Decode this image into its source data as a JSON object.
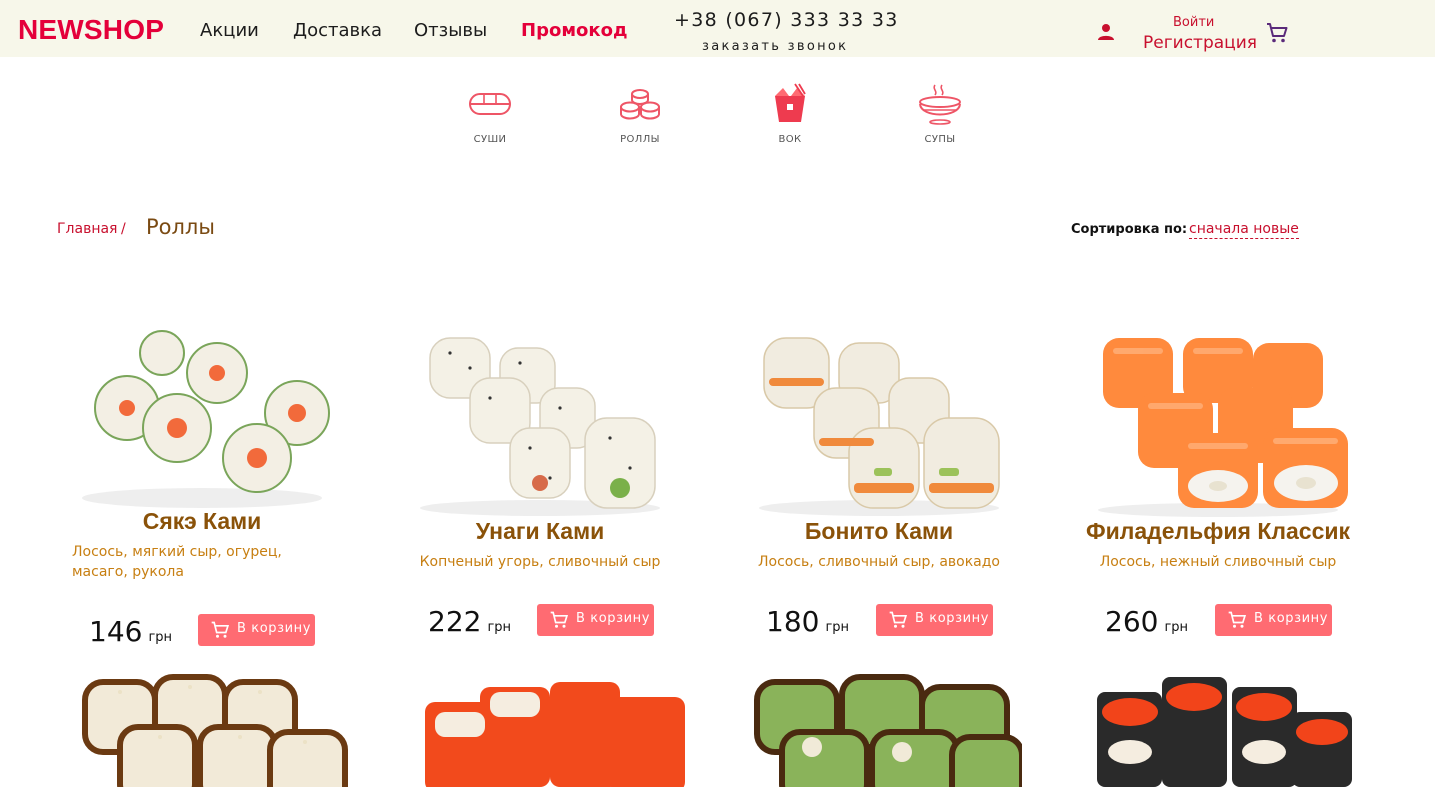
{
  "header": {
    "logo": "NEWSHOP",
    "nav": [
      {
        "label": "Акции"
      },
      {
        "label": "Доставка"
      },
      {
        "label": "Отзывы"
      },
      {
        "label": "Промокод"
      }
    ],
    "phone": "+38 (067) 333 33 33",
    "callback": "заказать звонок",
    "login": "Войти",
    "register": "Регистрация",
    "icons": [
      "user-icon",
      "cart-icon"
    ]
  },
  "categories": [
    {
      "label": "СУШИ",
      "icon": "sushi-icon"
    },
    {
      "label": "РОЛЛЫ",
      "icon": "rolls-icon"
    },
    {
      "label": "ВОК",
      "icon": "wok-icon"
    },
    {
      "label": "СУПЫ",
      "icon": "soup-icon"
    }
  ],
  "breadcrumb": {
    "home": "Главная",
    "separator": "/",
    "current": "Роллы"
  },
  "sort": {
    "label": "Сортировка по:",
    "value": "сначала новые"
  },
  "products": [
    {
      "name": "Сякэ Ками",
      "desc": "Лосось, мягкий сыр, огурец, масаго, рукола",
      "price": "146",
      "currency": "грн",
      "button": "В корзину"
    },
    {
      "name": "Унаги Ками",
      "desc": "Копченый угорь, сливочный сыр",
      "price": "222",
      "currency": "грн",
      "button": "В корзину"
    },
    {
      "name": "Бонито Ками",
      "desc": "Лосось, сливочный сыр, авокадо",
      "price": "180",
      "currency": "грн",
      "button": "В корзину"
    },
    {
      "name": "Филадельфия Классик",
      "desc": "Лосось, нежный сливочный сыр",
      "price": "260",
      "currency": "грн",
      "button": "В корзину"
    }
  ],
  "colors": {
    "brand": "#e4003a",
    "button": "#ff6b72",
    "product_title": "#8a5209",
    "product_desc": "#c77f12",
    "header_bg": "#f7f7ea"
  }
}
